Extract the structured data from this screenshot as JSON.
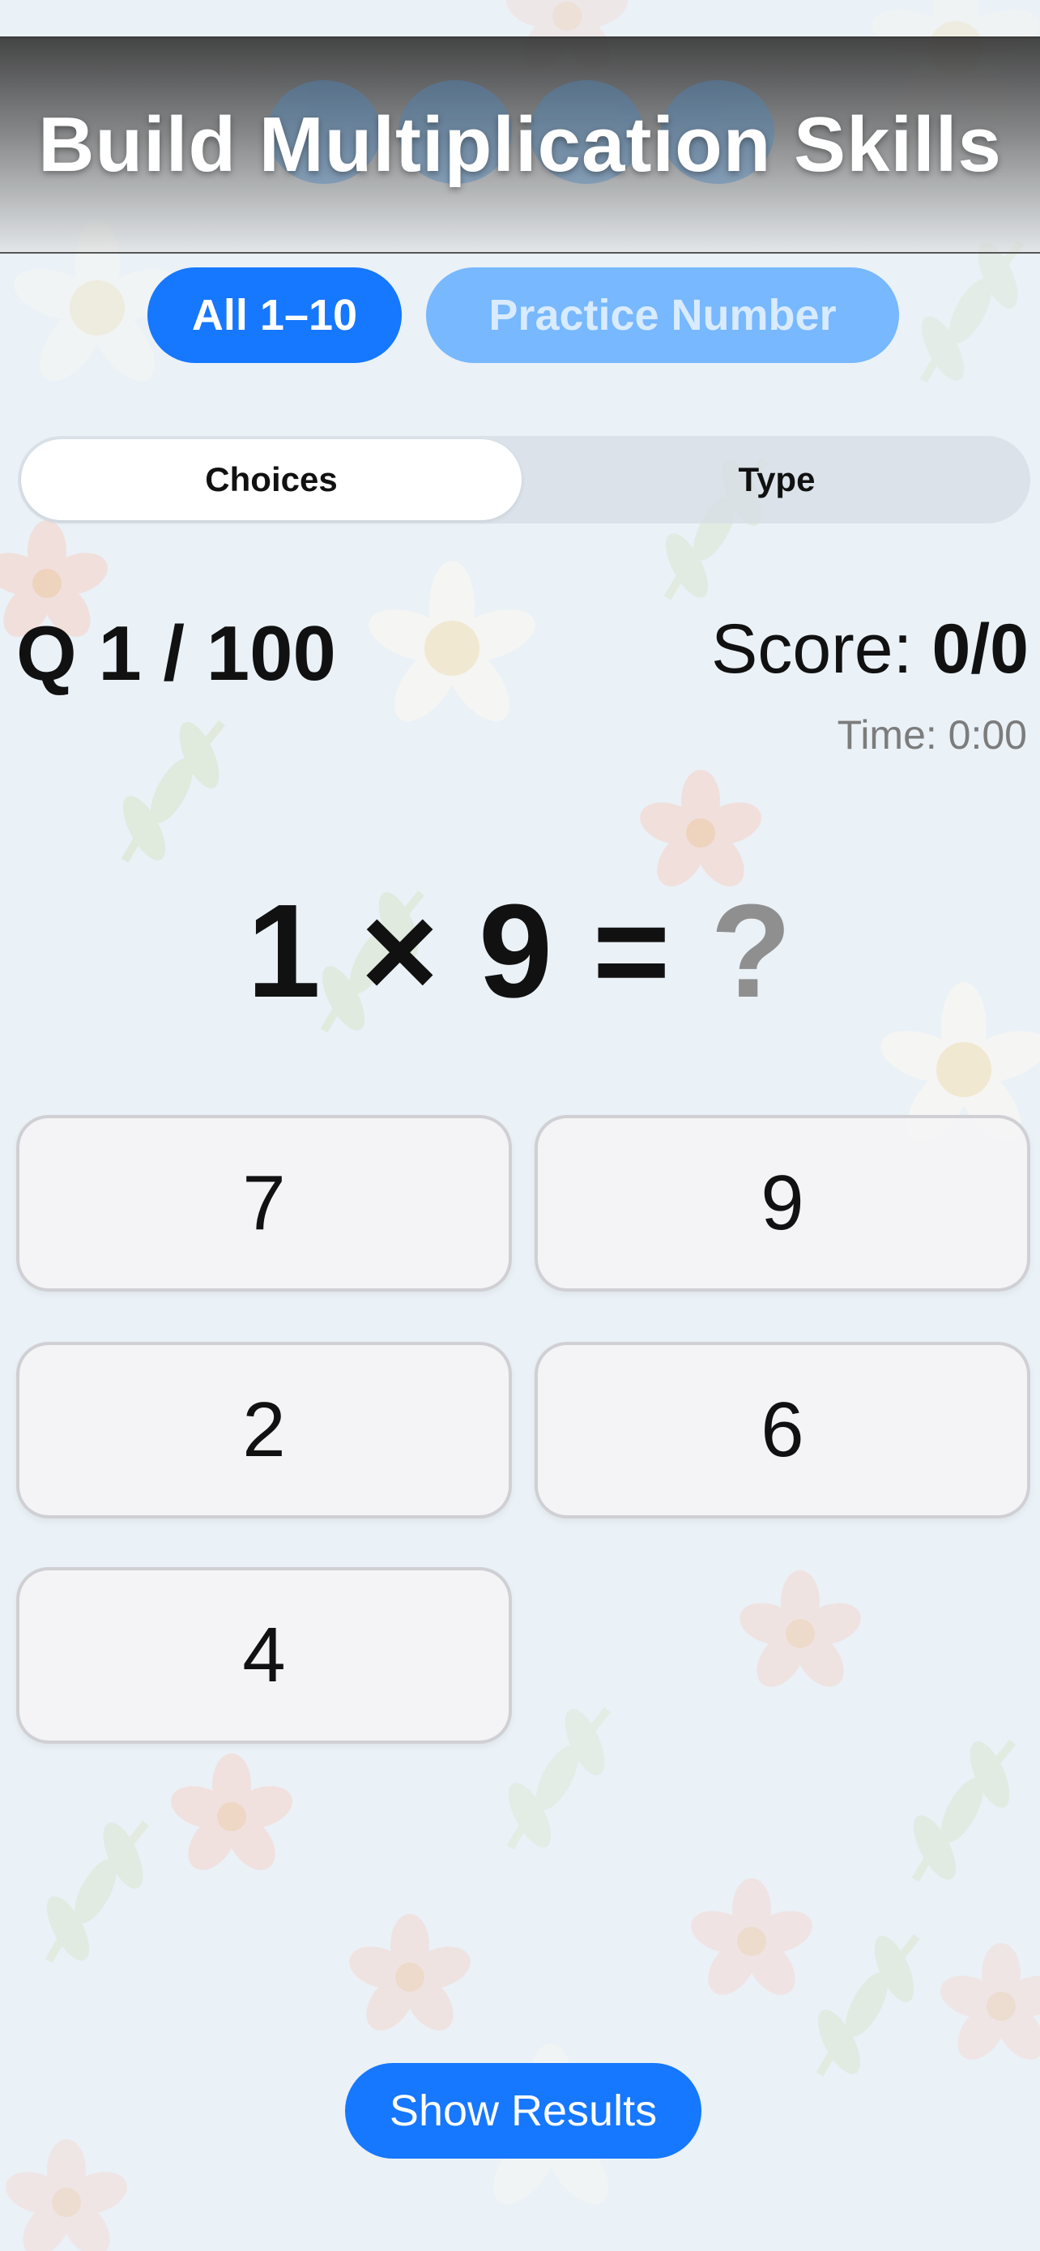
{
  "banner": {
    "title": "Build Multiplication Skills"
  },
  "mode": {
    "all_label": "All 1–10",
    "practice_label": "Practice Number"
  },
  "segmented": {
    "choices_label": "Choices",
    "type_label": "Type"
  },
  "status": {
    "question_counter": "Q 1 / 100",
    "score_label": "Score:",
    "score_value": "0/0",
    "time": "Time: 0:00"
  },
  "problem": {
    "left": "1",
    "operator": "×",
    "right": "9",
    "equals": "=",
    "unknown": "?"
  },
  "answers": [
    "7",
    "9",
    "2",
    "6",
    "4"
  ],
  "footer": {
    "show_results_label": "Show Results"
  },
  "colors": {
    "accent": "#1677ff",
    "accent_soft": "#77b8ff",
    "background": "#eaf1f7"
  },
  "icons": {
    "decorative": [
      "flower-icon",
      "leaf-icon"
    ]
  }
}
